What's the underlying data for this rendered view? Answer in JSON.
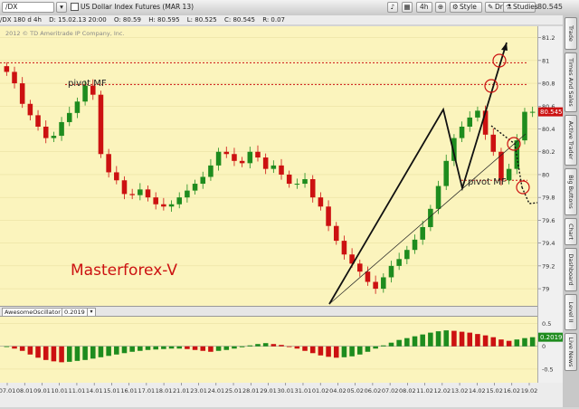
{
  "toolbar": {
    "symbol": "/DX",
    "description": "US Dollar Index Futures (MAR 13)",
    "timeframe": "4h",
    "style_label": "Style",
    "drawings_label": "Drawings",
    "studies_label": "Studies",
    "last_price": "80.545"
  },
  "ohlc": {
    "symbol_period": "/DX 180 d 4h",
    "date": "D: 15.02.13 20:00",
    "open": "O: 80.59",
    "high": "H: 80.595",
    "low": "L: 80.525",
    "close": "C: 80.545",
    "range": "R: 0.07"
  },
  "copyright": "2012 © TD Ameritrade IP Company, Inc.",
  "watermark": "Masterforex-V",
  "price_tag": "80.545",
  "annotations": {
    "pivot_left": "pivot MF",
    "pivot_right": "pivot MF"
  },
  "side_tabs": [
    "Trade",
    "Times And Sales",
    "Active Trader",
    "Big Buttons",
    "Chart",
    "Dashboard",
    "Level II",
    "Live News"
  ],
  "oscillator": {
    "label": "AwesomeOscillator",
    "value": "0.2019",
    "tag": "0.2019"
  },
  "colors": {
    "up": "#1e8c1e",
    "down": "#cc1111",
    "background": "#fbf4bd",
    "pivot_line": "#cc1111"
  },
  "chart_data": [
    {
      "type": "candlestick",
      "title": "US Dollar Index Futures (MAR 13)",
      "ylim": [
        78.85,
        81.3
      ],
      "yticks": [
        "81.2",
        "81",
        "80.8",
        "80.6",
        "80.4",
        "80.2",
        "80",
        "79.8",
        "79.6",
        "79.4",
        "79.2",
        "79"
      ],
      "xticks": [
        "07.01",
        "08.01",
        "09.01",
        "10.01",
        "11.01",
        "14.01",
        "15.01",
        "16.01",
        "17.01",
        "18.01",
        "21.01",
        "23.01",
        "24.01",
        "25.01",
        "28.01",
        "29.01",
        "30.01",
        "31.01",
        "01.02",
        "04.02",
        "05.02",
        "06.02",
        "07.02",
        "08.02",
        "11.02",
        "12.02",
        "13.02",
        "14.02",
        "15.02",
        "16.02",
        "19.02"
      ],
      "levels": [
        80.98,
        80.79,
        79.95
      ],
      "closes": [
        80.9,
        80.8,
        80.62,
        80.52,
        80.42,
        80.32,
        80.34,
        80.46,
        80.54,
        80.64,
        80.78,
        80.7,
        80.18,
        80.02,
        79.95,
        79.83,
        79.82,
        79.87,
        79.8,
        79.74,
        79.72,
        79.74,
        79.8,
        79.86,
        79.92,
        79.98,
        80.08,
        80.2,
        80.18,
        80.12,
        80.1,
        80.2,
        80.15,
        80.05,
        80.08,
        80.0,
        79.92,
        79.92,
        79.96,
        79.8,
        79.72,
        79.55,
        79.42,
        79.3,
        79.22,
        79.15,
        79.06,
        79.0,
        79.1,
        79.2,
        79.26,
        79.34,
        79.43,
        79.54,
        79.7,
        79.9,
        80.12,
        80.32,
        80.42,
        80.5,
        80.56,
        80.35,
        80.2,
        79.95,
        80.05,
        80.3,
        80.55,
        80.55
      ],
      "ao": [
        -0.0,
        -0.05,
        -0.1,
        -0.18,
        -0.25,
        -0.3,
        -0.33,
        -0.35,
        -0.34,
        -0.32,
        -0.3,
        -0.27,
        -0.24,
        -0.21,
        -0.18,
        -0.15,
        -0.12,
        -0.1,
        -0.08,
        -0.07,
        -0.06,
        -0.05,
        -0.05,
        -0.06,
        -0.08,
        -0.1,
        -0.12,
        -0.1,
        -0.08,
        -0.05,
        -0.02,
        0.02,
        0.05,
        0.07,
        0.05,
        0.03,
        0.0,
        -0.05,
        -0.1,
        -0.15,
        -0.2,
        -0.23,
        -0.25,
        -0.24,
        -0.22,
        -0.18,
        -0.12,
        -0.05,
        0.02,
        0.08,
        0.14,
        0.18,
        0.22,
        0.26,
        0.3,
        0.33,
        0.35,
        0.34,
        0.32,
        0.3,
        0.27,
        0.24,
        0.2,
        0.15,
        0.12,
        0.15,
        0.18,
        0.2
      ],
      "ao_yticks": [
        "0.5",
        "0",
        "-0.5"
      ],
      "ao_ylim": [
        -0.8,
        0.65
      ]
    }
  ]
}
